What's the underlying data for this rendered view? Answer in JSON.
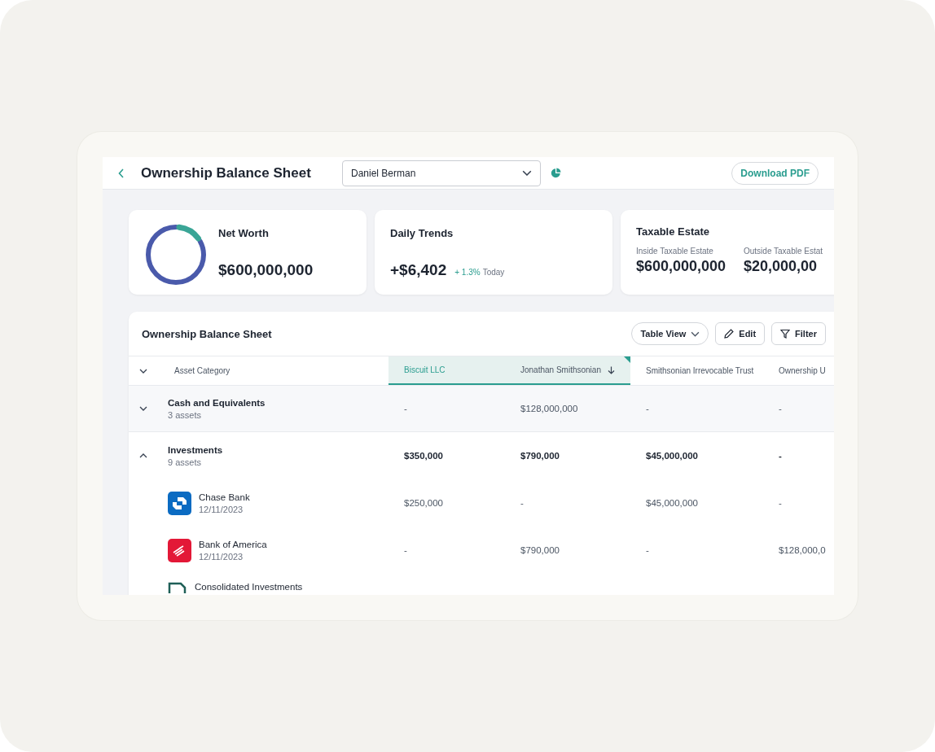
{
  "header": {
    "title": "Ownership Balance Sheet",
    "person_select": {
      "value": "Daniel Berman"
    },
    "download_button": "Download PDF"
  },
  "cards": [
    {
      "kind": "net_worth",
      "title": "Net Worth",
      "value": "$600,000,000"
    },
    {
      "kind": "trend",
      "title": "Daily Trends",
      "value": "+$6,402",
      "change": "+ 1.3%",
      "period": "Today"
    },
    {
      "kind": "estate",
      "title": "Taxable Estate",
      "items": [
        {
          "label": "Inside Taxable Estate",
          "value": "$600,000,000"
        },
        {
          "label": "Outside Taxable Estat",
          "value": "$20,000,00"
        }
      ]
    }
  ],
  "table": {
    "title": "Ownership Balance Sheet",
    "view_select": "Table View",
    "buttons": [
      "Edit",
      "Filter"
    ],
    "columns": [
      {
        "label": "Asset Category",
        "selected": false,
        "sorted": false
      },
      {
        "label": "Biscuit LLC",
        "selected": true,
        "sorted": false
      },
      {
        "label": "Jonathan Smithsonian",
        "selected": false,
        "sorted": true
      },
      {
        "label": "Smithsonian Irrevocable Trust",
        "selected": false,
        "sorted": false
      },
      {
        "label": "Ownership U",
        "selected": false
      }
    ],
    "rows": [
      {
        "kind": "group",
        "name": "Cash and Equivalents",
        "count": "3 assets",
        "expanded": false,
        "values": [
          "-",
          "$128,000,000",
          "-",
          "-"
        ]
      },
      {
        "kind": "group",
        "name": "Investments",
        "count": "9 assets",
        "expanded": true,
        "values": [
          "$350,000",
          "$790,000",
          "$45,000,000",
          "-"
        ]
      },
      {
        "kind": "asset",
        "logo": {
          "kind": "chase"
        },
        "name": "Chase Bank",
        "date": "12/11/2023",
        "values": [
          "$250,000",
          "-",
          "$45,000,000",
          "-"
        ]
      },
      {
        "kind": "asset",
        "logo": {
          "kind": "bofa"
        },
        "name": "Bank of America",
        "date": "12/11/2023",
        "values": [
          "-",
          "$790,000",
          "-",
          "$128,000,0"
        ]
      },
      {
        "kind": "asset",
        "logo": {
          "kind": "document"
        },
        "name": "Consolidated Investments"
      }
    ]
  }
}
